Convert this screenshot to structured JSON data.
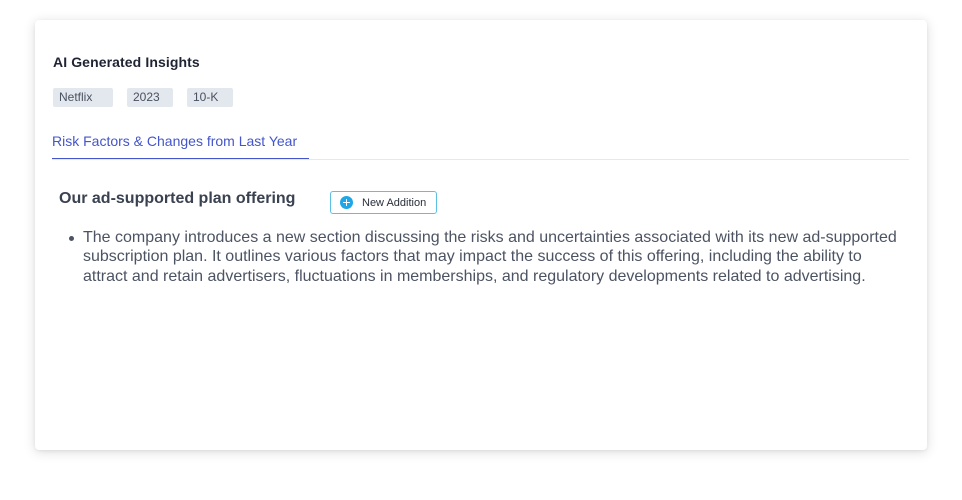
{
  "card": {
    "title": "AI Generated Insights",
    "tags": [
      "Netflix",
      "2023",
      "10-K"
    ]
  },
  "tabs": [
    {
      "label": "Risk Factors & Changes from Last Year",
      "active": true
    }
  ],
  "section": {
    "title": "Our ad-supported plan offering",
    "badge": {
      "label": "New Addition",
      "icon": "plus-circle-icon",
      "color": "#1fa6e6"
    },
    "bullets": [
      "The company introduces a new section discussing the risks and uncertainties associated with its new ad-supported subscription plan. It outlines various factors that may impact the success of this offering, including the ability to attract and retain advertisers, fluctuations in memberships, and regulatory developments related to advertising."
    ]
  },
  "colors": {
    "accent": "#4456c9",
    "tag_bg": "#e3e7ee",
    "badge_border": "#5cc0e6"
  }
}
